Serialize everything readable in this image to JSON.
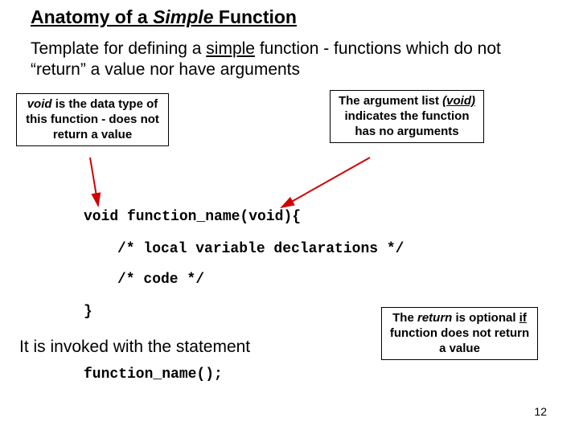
{
  "title": {
    "pre": "Anatomy of a ",
    "em": "Simple",
    "post": " Function"
  },
  "intro": {
    "t1": "Template for defining a ",
    "ul": "simple",
    "t2": " function - functions which do not “return” a value nor have arguments"
  },
  "box1": {
    "kw": "void",
    "rest": " is the data type of this function - does not return a value"
  },
  "box2": {
    "t1": "The argument list ",
    "kw": "(void)",
    "t2": " indicates the function has no arguments"
  },
  "box3": {
    "t1": "The ",
    "kw": "return",
    "t2": " is optional ",
    "ul": "if",
    "t3": " function does not return a value"
  },
  "code": {
    "sig": "void function_name(void){",
    "decl": "/* local variable declarations */",
    "body": "/* code */",
    "close": "}",
    "call": "function_name();"
  },
  "invoke_text": "It is invoked with the statement",
  "page": "12"
}
